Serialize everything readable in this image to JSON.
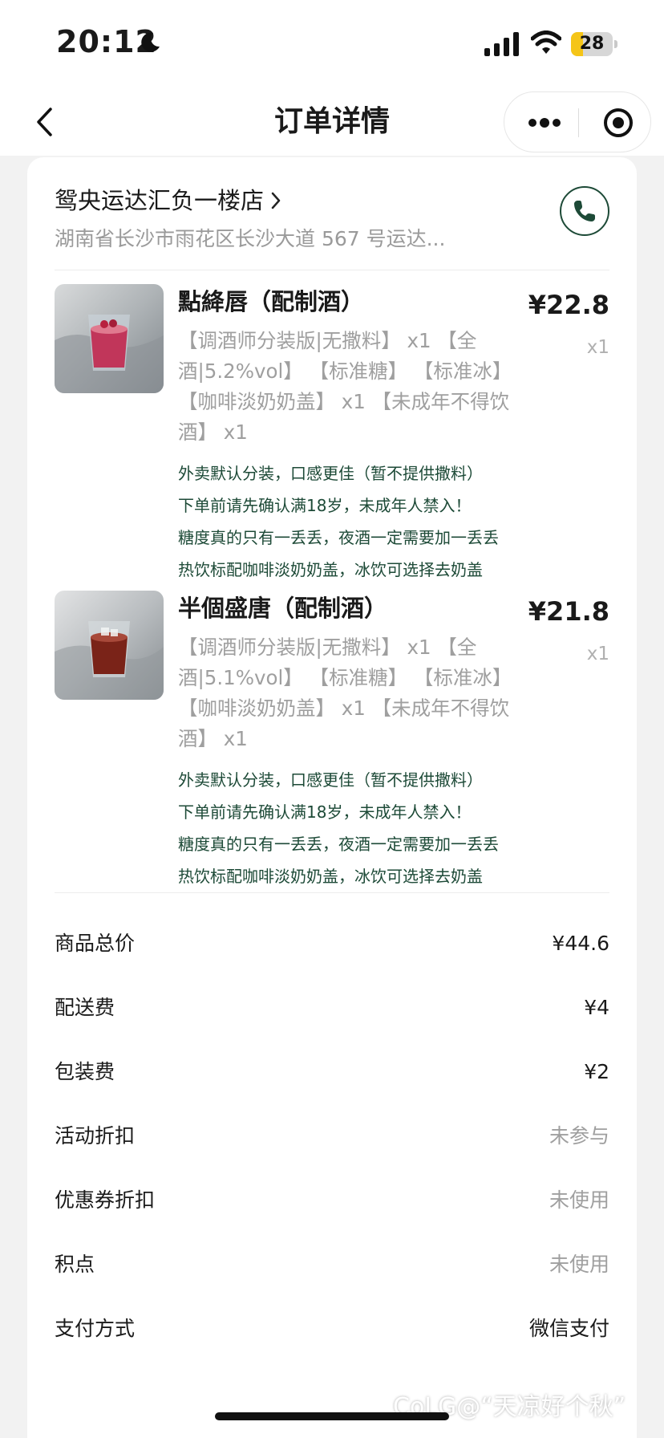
{
  "status_bar": {
    "time": "20:12",
    "battery_text": "28",
    "battery_level": 0.28,
    "accent_color": "#f5c518"
  },
  "nav": {
    "title": "订单详情",
    "icons": [
      "chevron-left-icon",
      "more-dots-icon",
      "close-target-icon"
    ]
  },
  "store": {
    "name": "鸳央运达汇负一楼店",
    "address": "湖南省长沙市雨花区长沙大道 567 号运达...",
    "brand_color": "#1d4a37"
  },
  "products": [
    {
      "name": "點絳唇（配制酒）",
      "price": "¥22.8",
      "quantity": "x1",
      "spec": "【调酒师分装版|无撒料】 x1 【全酒|5.2%vol】 【标准糖】 【标准冰】 【咖啡淡奶奶盖】 x1 【未成年不得饮酒】 x1",
      "notes": [
        "外卖默认分装，口感更佳（暂不提供撒料）",
        "下单前请先确认满18岁，未成年人禁入！",
        "糖度真的只有一丢丢，夜酒一定需要加一丢丢",
        "热饮标配咖啡淡奶奶盖，冰饮可选择去奶盖"
      ]
    },
    {
      "name": "半個盛唐（配制酒）",
      "price": "¥21.8",
      "quantity": "x1",
      "spec": "【调酒师分装版|无撒料】 x1 【全酒|5.1%vol】 【标准糖】 【标准冰】 【咖啡淡奶奶盖】 x1 【未成年不得饮酒】 x1",
      "notes": [
        "外卖默认分装，口感更佳（暂不提供撒料）",
        "下单前请先确认满18岁，未成年人禁入！",
        "糖度真的只有一丢丢，夜酒一定需要加一丢丢",
        "热饮标配咖啡淡奶奶盖，冰饮可选择去奶盖"
      ]
    }
  ],
  "fees": [
    {
      "label": "商品总价",
      "value": "¥44.6"
    },
    {
      "label": "配送费",
      "value": "¥4"
    },
    {
      "label": "包装费",
      "value": "¥2"
    },
    {
      "label": "活动折扣",
      "value": "未参与"
    },
    {
      "label": "优惠券折扣",
      "value": "未使用"
    },
    {
      "label": "积点",
      "value": "未使用"
    },
    {
      "label": "支付方式",
      "value": "微信支付"
    }
  ],
  "watermark": "CoLG@“天凉好个秋”"
}
